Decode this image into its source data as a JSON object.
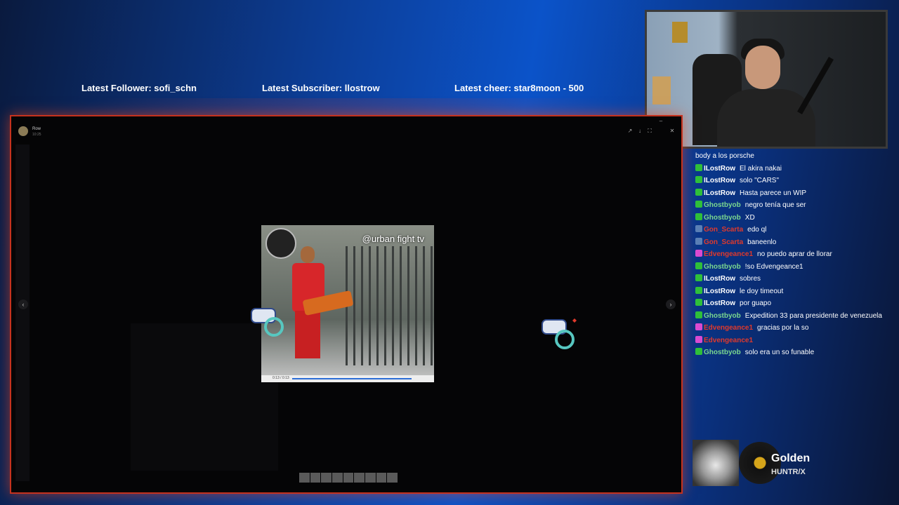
{
  "overlay": {
    "latest_follower": "Latest Follower: sofi_schn",
    "latest_subscriber": "Latest Subscriber: llostrow",
    "latest_cheer": "Latest cheer: star8moon - 500"
  },
  "window": {
    "title": "Row",
    "subtitle": "10:25"
  },
  "video": {
    "watermark": "@urban fight tv",
    "time": "0:13 / 0:13"
  },
  "chat": {
    "messages": [
      {
        "user": "",
        "text": "body a los porsche",
        "color": "#ffffff"
      },
      {
        "user": "ILostRow",
        "text": "El akira nakai",
        "color": "#ffffff",
        "badge": "#2fbf3a"
      },
      {
        "user": "ILostRow",
        "text": "solo \"CARS\"",
        "color": "#ffffff",
        "badge": "#2fbf3a"
      },
      {
        "user": "ILostRow",
        "text": "Hasta parece un WIP",
        "color": "#ffffff",
        "badge": "#2fbf3a"
      },
      {
        "user": "Ghostbyob",
        "text": "negro tenía que ser",
        "color": "#7bd88f",
        "badge": "#2fbf3a"
      },
      {
        "user": "Ghostbyob",
        "text": "XD",
        "color": "#7bd88f",
        "badge": "#2fbf3a"
      },
      {
        "user": "Gon_Scarta",
        "text": "edo ql",
        "color": "#e0392b",
        "badge": "#5a7fb5"
      },
      {
        "user": "Gon_Scarta",
        "text": "baneenlo",
        "color": "#e0392b",
        "badge": "#5a7fb5"
      },
      {
        "user": "Edvengeance1",
        "text": "no puedo aprar de llorar",
        "color": "#e0392b",
        "badge": "#d94ad1"
      },
      {
        "user": "Ghostbyob",
        "text": "!so Edvengeance1",
        "color": "#7bd88f",
        "badge": "#2fbf3a"
      },
      {
        "user": "ILostRow",
        "text": "sobres",
        "color": "#ffffff",
        "badge": "#2fbf3a"
      },
      {
        "user": "ILostRow",
        "text": "le doy timeout",
        "color": "#ffffff",
        "badge": "#2fbf3a"
      },
      {
        "user": "ILostRow",
        "text": "por guapo",
        "color": "#ffffff",
        "badge": "#2fbf3a"
      },
      {
        "user": "Ghostbyob",
        "text": "Expedition 33 para presidente de venezuela",
        "color": "#7bd88f",
        "badge": "#2fbf3a"
      },
      {
        "user": "Edvengeance1",
        "text": "gracias por la so",
        "color": "#e0392b",
        "badge": "#d94ad1"
      },
      {
        "user": "Edvengeance1",
        "text": "",
        "color": "#e0392b",
        "badge": "#d94ad1"
      },
      {
        "user": "Ghostbyob",
        "text": "solo era un so funable",
        "color": "#7bd88f",
        "badge": "#2fbf3a"
      }
    ]
  },
  "now_playing": {
    "song": "Golden",
    "artist": "HUNTR/X"
  },
  "icons": {
    "prev": "chevron-left-icon",
    "next": "chevron-right-icon",
    "close": "close-icon"
  }
}
